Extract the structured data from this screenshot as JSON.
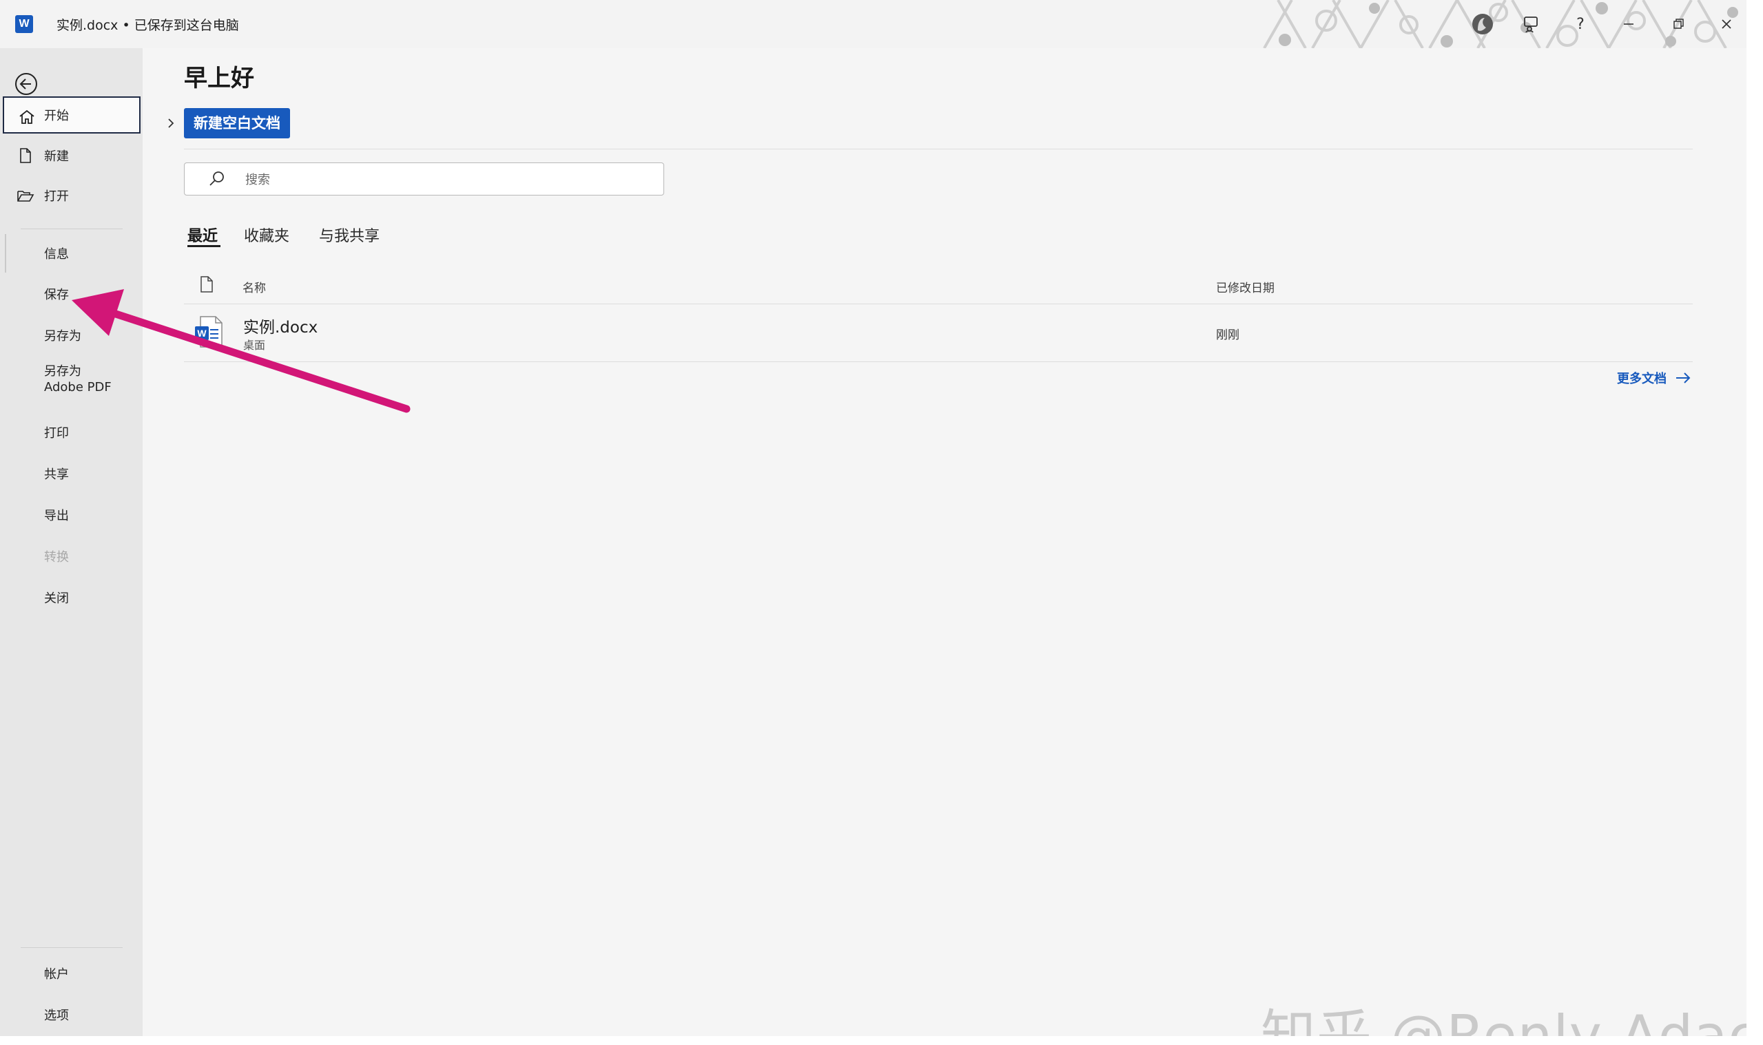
{
  "titlebar": {
    "app_logo": "W",
    "document_title": "实例.docx • 已保存到这台电脑",
    "icons": [
      "account-avatar-icon",
      "feedback-icon",
      "help-icon",
      "minimize-icon",
      "restore-icon",
      "close-icon"
    ],
    "help_glyph": "?"
  },
  "sidebar": {
    "back_icon": "back-arrow-icon",
    "top_items": [
      {
        "label": "开始",
        "icon": "home-icon",
        "active": true
      },
      {
        "label": "新建",
        "icon": "new-document-icon"
      },
      {
        "label": "打开",
        "icon": "open-folder-icon"
      }
    ],
    "items": [
      {
        "label": "信息"
      },
      {
        "label": "保存"
      },
      {
        "label": "另存为"
      },
      {
        "label_line1": "另存为",
        "label_line2": "Adobe PDF"
      },
      {
        "label": "打印"
      },
      {
        "label": "共享"
      },
      {
        "label": "导出"
      },
      {
        "label": "转换",
        "disabled": true
      },
      {
        "label": "关闭"
      }
    ],
    "bottom_items": [
      {
        "label": "帐户"
      },
      {
        "label": "选项"
      }
    ]
  },
  "main": {
    "greeting": "早上好",
    "new_blank_label": "新建空白文档",
    "search": {
      "placeholder": "搜索",
      "value": ""
    },
    "tabs": [
      {
        "label": "最近",
        "active": true
      },
      {
        "label": "收藏夹"
      },
      {
        "label": "与我共享"
      }
    ],
    "list": {
      "columns": {
        "name": "名称",
        "modified": "已修改日期"
      },
      "rows": [
        {
          "name": "实例.docx",
          "location": "桌面",
          "modified": "刚刚",
          "icon": "word-file-icon"
        }
      ]
    },
    "more_docs_label": "更多文档"
  },
  "watermark": "知乎 @Renly Adace",
  "colors": {
    "accent": "#185abd",
    "sidebar_bg": "#e7e7e7",
    "content_bg": "#f5f5f5",
    "annotation_arrow": "#d21677"
  }
}
